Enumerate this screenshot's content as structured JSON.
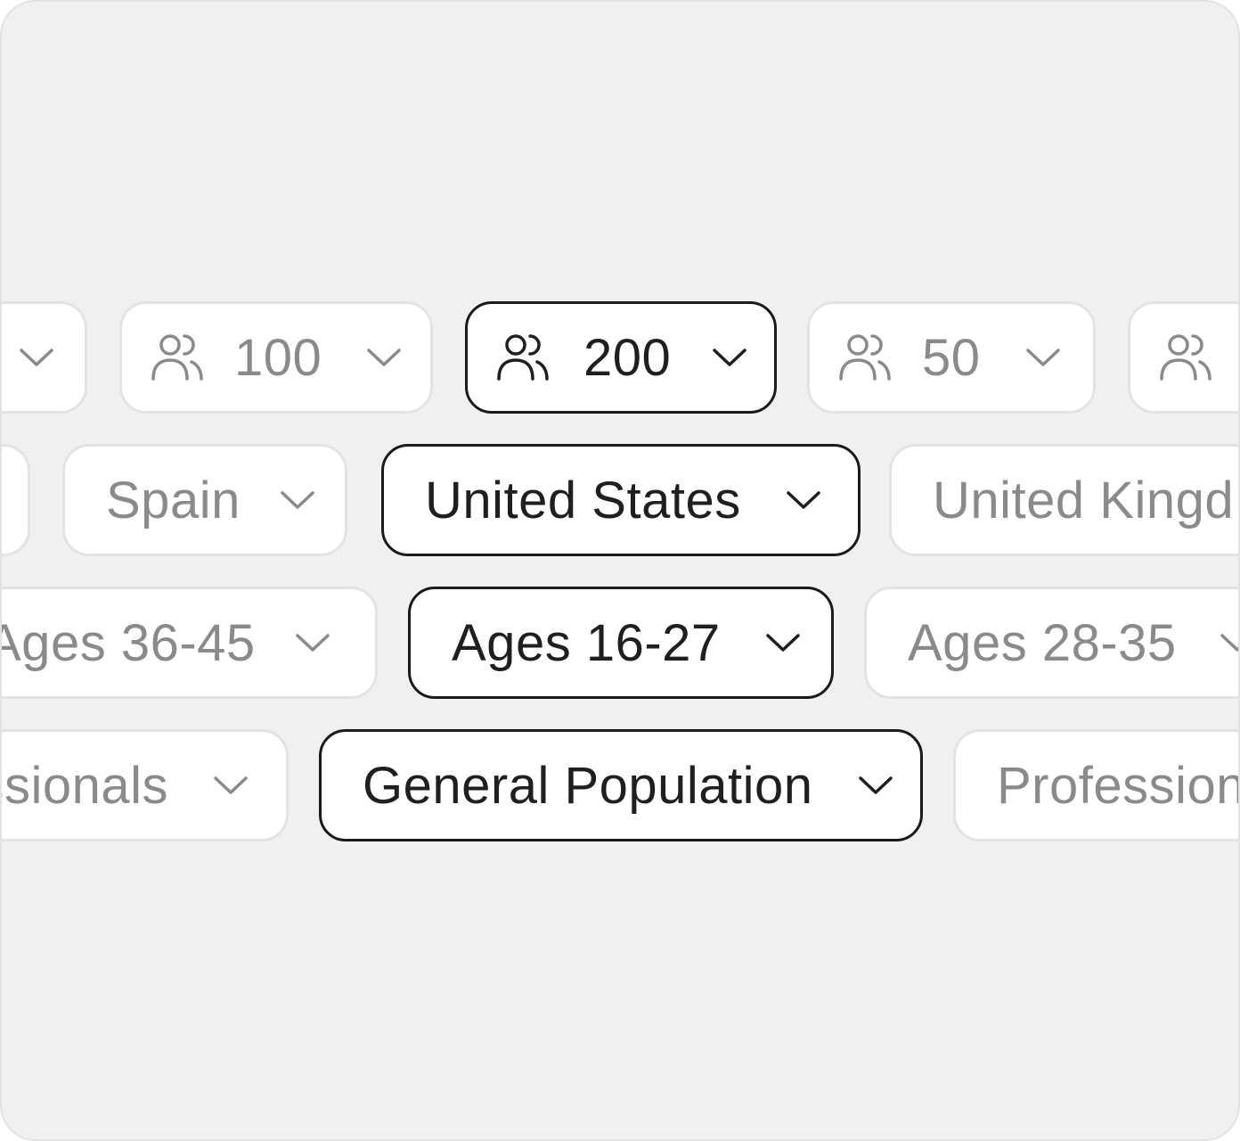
{
  "rows": {
    "count": {
      "cut_left": "",
      "items": [
        "100",
        "200",
        "50"
      ],
      "selected": "200"
    },
    "country": {
      "cut_left": "",
      "items": [
        "Spain",
        "United States",
        "United Kingd"
      ],
      "selected": "United States"
    },
    "age": {
      "items": [
        "Ages 36-45",
        "Ages 16-27",
        "Ages 28-35"
      ],
      "selected": "Ages 16-27"
    },
    "audience": {
      "items": [
        "ssionals",
        "General Population",
        "Profession"
      ],
      "selected": "General Population"
    }
  },
  "icons": {
    "participants": "users-icon",
    "dropdown": "chevron-down-icon"
  },
  "colors": {
    "background": "#f0f0f0",
    "pill": "#ffffff",
    "pill_border": "#e3e3e3",
    "active_border": "#1a1a1a",
    "inactive_text": "#8a8a8a",
    "active_text": "#1f1f1f"
  }
}
